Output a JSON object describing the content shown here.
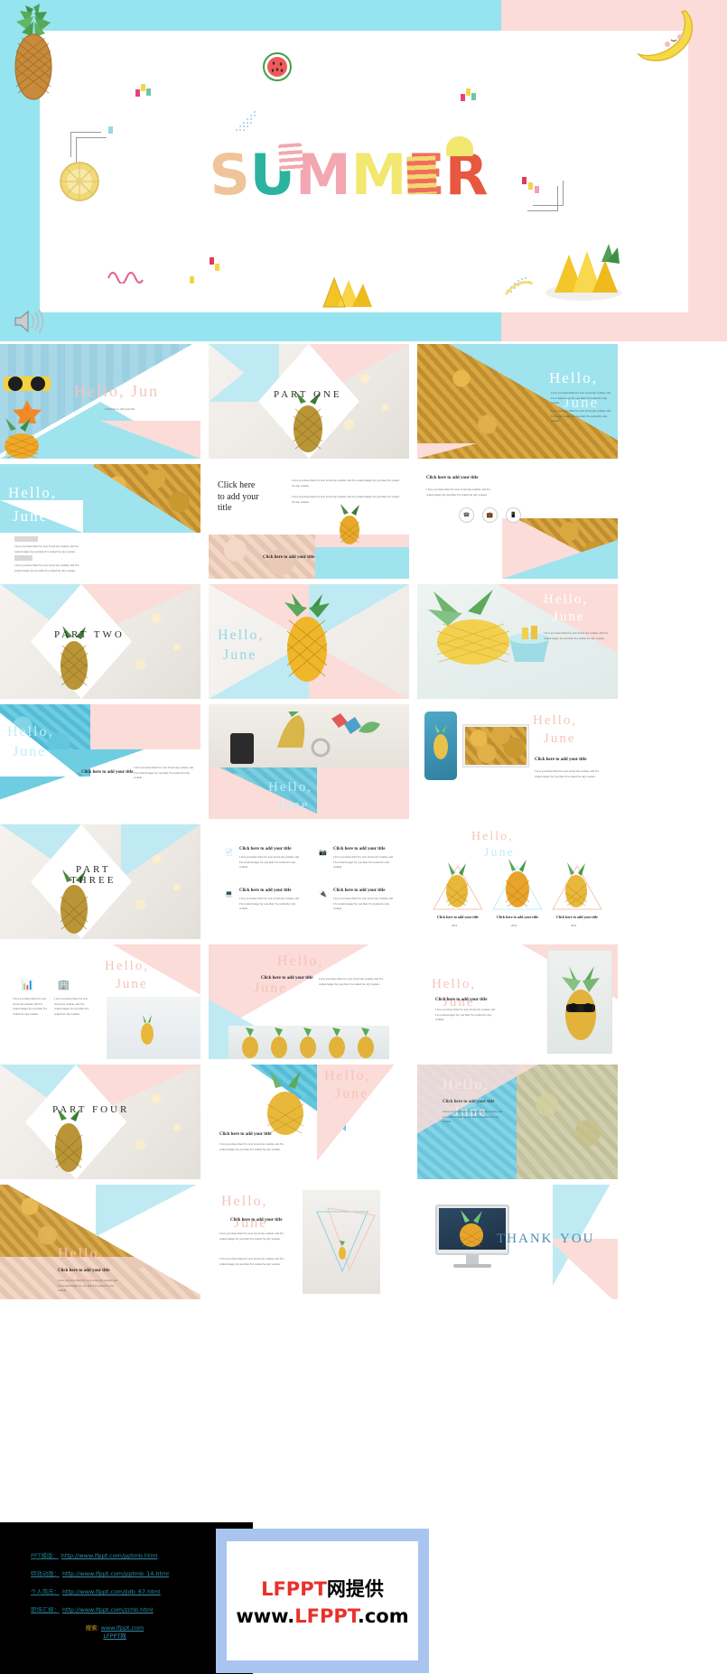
{
  "cover": {
    "title_word": "SUMMER",
    "letters": [
      "S",
      "U",
      "M",
      "M",
      "E",
      "R"
    ],
    "bg_cyan": "#96e4f0",
    "bg_pink": "#fbdcd8",
    "speaker_icon": "speaker-icon",
    "decor": [
      "pineapple",
      "banana",
      "watermelon",
      "pineapple-slice",
      "pineapple-wedges",
      "pineapple-plate",
      "confetti",
      "squiggle",
      "dot-fan",
      "corner-bracket"
    ]
  },
  "common": {
    "hello": "Hello,",
    "june": "June",
    "hello_june": "Hello,  June",
    "click_title": "Click here to add your title",
    "click_title_break": "Click here\nto add your\ntitle",
    "lorem": "I love you more than I've ever loved any woman, and I've waited longer for you than I've waited for any woman.",
    "lorem_short": "I love you more than I've ever loved any woman, and I've waited longer for you than I've waited for any woman.",
    "year": "2019",
    "thank": "THANK",
    "you": "YOU"
  },
  "slides": [
    {
      "n": 1,
      "kind": "hello-sunglasses",
      "title": "Hello,  Jun",
      "year": "2019",
      "sub": "Click here to add your title"
    },
    {
      "n": 2,
      "kind": "part-diamond",
      "part": "PART   ONE"
    },
    {
      "n": 3,
      "kind": "hello-photo-cyan",
      "hello": "Hello,",
      "june": "June"
    },
    {
      "n": 4,
      "kind": "hello-left-cyan",
      "hello": "Hello,",
      "june": "June"
    },
    {
      "n": 5,
      "kind": "click-title-body",
      "title": "Click here\nto add your\ntitle"
    },
    {
      "n": 6,
      "kind": "icons-three",
      "title": "Click here to add your title",
      "icons": [
        "phone-icon",
        "briefcase-icon",
        "mobile-icon"
      ]
    },
    {
      "n": 7,
      "kind": "part-diamond",
      "part": "PART   TWO"
    },
    {
      "n": 8,
      "kind": "hello-pineapple-center",
      "hello": "Hello,",
      "june": "June"
    },
    {
      "n": 9,
      "kind": "hello-bowl",
      "hello": "Hello,",
      "june": "June"
    },
    {
      "n": 10,
      "kind": "hello-water-left",
      "hello": "Hello,",
      "june": "June",
      "title": "Click here to add your title"
    },
    {
      "n": 11,
      "kind": "desk-photo-hello",
      "hello": "Hello,",
      "june": "June"
    },
    {
      "n": 12,
      "kind": "devices",
      "title": "Click here to add your title",
      "hello": "Hello,",
      "june": "June"
    },
    {
      "n": 13,
      "kind": "part-diamond",
      "part": "PART\nTHREE"
    },
    {
      "n": 14,
      "kind": "four-icons",
      "items": [
        "Click here to add your title",
        "Click here to add your title",
        "Click here to add your title",
        "Click here to add your title"
      ]
    },
    {
      "n": 15,
      "kind": "three-triangles",
      "hello": "Hello,",
      "june": "June",
      "captions": [
        "Click here to add your title",
        "Click here to add your title",
        "Click here to add your title"
      ]
    },
    {
      "n": 16,
      "kind": "two-icons-hello",
      "hello": "Hello,",
      "june": "June"
    },
    {
      "n": 17,
      "kind": "hello-beach-pines",
      "hello": "Hello,",
      "june": "June",
      "title": "Click here to add your title"
    },
    {
      "n": 18,
      "kind": "hello-sunglasses-pine",
      "hello": "Hello,",
      "june": "June",
      "title": "Click here to add your title"
    },
    {
      "n": 19,
      "kind": "part-diamond",
      "part": "PART   FOUR"
    },
    {
      "n": 20,
      "kind": "hello-water-pine",
      "hello": "Hello,",
      "june": "June",
      "title": "Click here to add your title"
    },
    {
      "n": 21,
      "kind": "hello-pines-cyan",
      "hello": "Hello,",
      "june": "June",
      "title": "Click here to add your title"
    },
    {
      "n": 22,
      "kind": "hello-pines-pink",
      "hello": "Hello,",
      "june": "June",
      "title": "Click here to add your title"
    },
    {
      "n": 23,
      "kind": "triangle-minimal",
      "hello": "Hello,",
      "june": "June",
      "title": "Click here to add your title"
    },
    {
      "n": 24,
      "kind": "thank-you",
      "thank": "THANK",
      "you": "YOU"
    }
  ],
  "footer": {
    "links": [
      {
        "label": "PPT模版：",
        "url": "http://www.lfppt.com/pptmb.html"
      },
      {
        "label": "特效动画：",
        "url": "http://www.lfppt.com/pptmb_14.html"
      },
      {
        "label": "个人简历：",
        "url": "http://www.lfppt.com/jldb_67.html"
      },
      {
        "label": "职场汇报：",
        "url": "http://www.lfppt.com/zchb.html"
      }
    ],
    "search_label": "搜索:",
    "search_url": "www.lfppt.com",
    "search_site": "LFPPT网",
    "logo_line1_red": "LFPPT",
    "logo_line1_black": "网提供",
    "logo_line2_a": "www.",
    "logo_line2_red": "LFPPT",
    "logo_line2_b": ".com",
    "border_color": "#a9c4ef"
  }
}
